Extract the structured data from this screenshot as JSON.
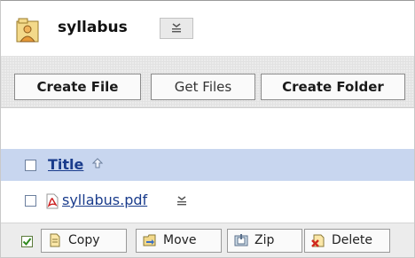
{
  "header": {
    "folder_name": "syllabus",
    "folder_icon": "folder-user-icon",
    "menu_icon": "dropdown-menu-icon"
  },
  "toolbar": {
    "create_file": "Create File",
    "get_files": "Get Files",
    "create_folder": "Create Folder"
  },
  "table": {
    "title_column": "Title",
    "sort_icon": "sort-ascending-icon",
    "rows": [
      {
        "name": "syllabus.pdf",
        "icon": "pdf-icon",
        "checked": false
      }
    ]
  },
  "actions": {
    "select_all_icon": "checkbox-checked-icon",
    "copy": "Copy",
    "move": "Move",
    "zip": "Zip",
    "delete": "Delete"
  },
  "colors": {
    "header_row": "#c8d6ef",
    "link": "#1a3c8c",
    "toolbar_bg": "#ececec"
  }
}
